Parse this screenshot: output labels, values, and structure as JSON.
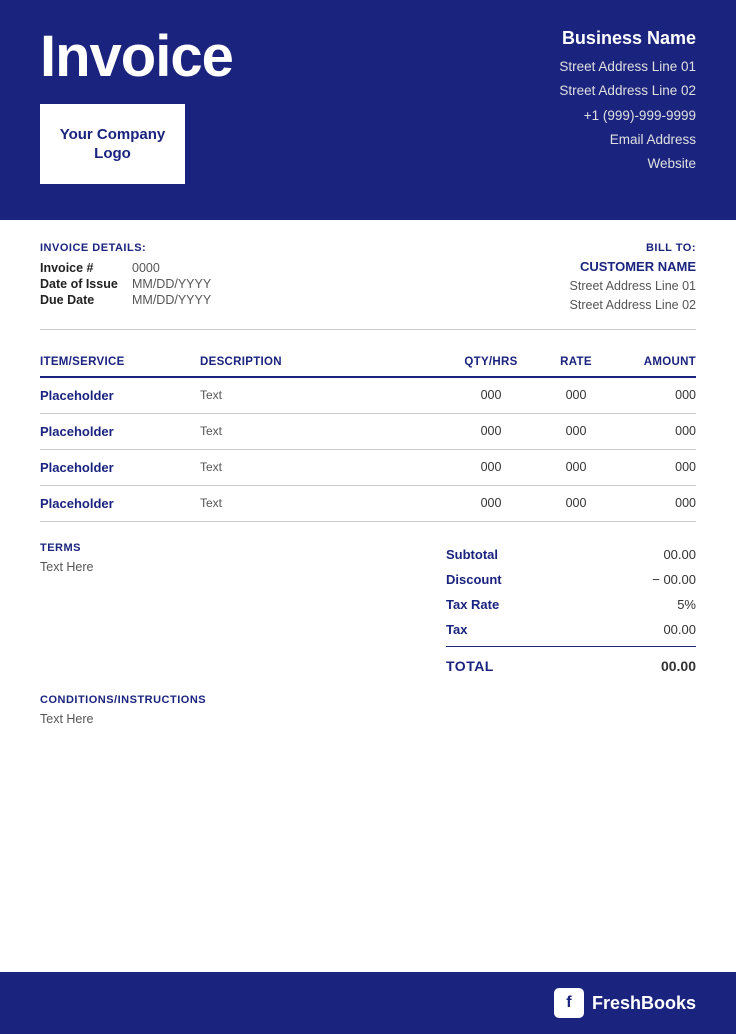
{
  "header": {
    "invoice_title": "Invoice",
    "logo_text": "Your Company Logo",
    "business_name": "Business Name",
    "address_line1": "Street Address Line 01",
    "address_line2": "Street Address Line 02",
    "phone": "+1 (999)-999-9999",
    "email": "Email Address",
    "website": "Website"
  },
  "invoice_details": {
    "section_label": "INVOICE DETAILS:",
    "fields": [
      {
        "label": "Invoice #",
        "value": "0000"
      },
      {
        "label": "Date of Issue",
        "value": "MM/DD/YYYY"
      },
      {
        "label": "Due Date",
        "value": "MM/DD/YYYY"
      }
    ]
  },
  "bill_to": {
    "section_label": "BILL TO:",
    "customer_name": "CUSTOMER NAME",
    "address_line1": "Street Address Line 01",
    "address_line2": "Street Address Line 02"
  },
  "table": {
    "headers": [
      {
        "label": "ITEM/SERVICE",
        "align": "left"
      },
      {
        "label": "DESCRIPTION",
        "align": "left"
      },
      {
        "label": "QTY/HRS",
        "align": "center"
      },
      {
        "label": "RATE",
        "align": "center"
      },
      {
        "label": "AMOUNT",
        "align": "right"
      }
    ],
    "rows": [
      {
        "item": "Placeholder",
        "desc": "Text",
        "qty": "000",
        "rate": "000",
        "amount": "000"
      },
      {
        "item": "Placeholder",
        "desc": "Text",
        "qty": "000",
        "rate": "000",
        "amount": "000"
      },
      {
        "item": "Placeholder",
        "desc": "Text",
        "qty": "000",
        "rate": "000",
        "amount": "000"
      },
      {
        "item": "Placeholder",
        "desc": "Text",
        "qty": "000",
        "rate": "000",
        "amount": "000"
      }
    ]
  },
  "terms": {
    "label": "TERMS",
    "text": "Text Here"
  },
  "totals": {
    "subtotal_label": "Subtotal",
    "subtotal_value": "00.00",
    "discount_label": "Discount",
    "discount_value": "− 00.00",
    "taxrate_label": "Tax Rate",
    "taxrate_value": "5%",
    "tax_label": "Tax",
    "tax_value": "00.00",
    "total_label": "TOTAL",
    "total_value": "00.00"
  },
  "conditions": {
    "label": "CONDITIONS/INSTRUCTIONS",
    "text": "Text Here"
  },
  "footer": {
    "brand": "FreshBooks",
    "icon_letter": "f"
  }
}
